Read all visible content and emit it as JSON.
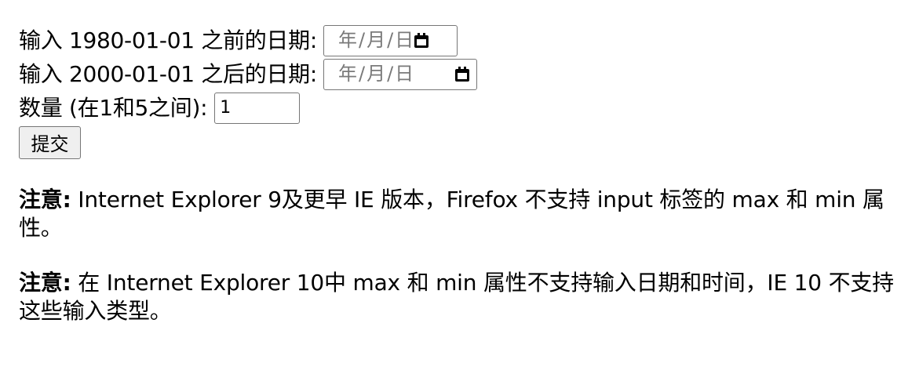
{
  "form": {
    "date_before_label": "输入 1980-01-01 之前的日期:",
    "date_after_label": "输入 2000-01-01 之后的日期:",
    "date_placeholder": {
      "year": "年",
      "month": "月",
      "day": "日",
      "separator": "/"
    },
    "quantity_label": "数量 (在1和5之间):",
    "quantity_value": "1",
    "submit_label": "提交"
  },
  "notes": [
    {
      "prefix": "注意:",
      "text": " Internet Explorer 9及更早 IE 版本，Firefox 不支持 input 标签的 max 和 min 属性。"
    },
    {
      "prefix": "注意:",
      "text": " 在 Internet Explorer 10中 max 和 min 属性不支持输入日期和时间，IE 10 不支持这些输入类型。"
    }
  ],
  "icons": {
    "calendar": "calendar-icon"
  }
}
